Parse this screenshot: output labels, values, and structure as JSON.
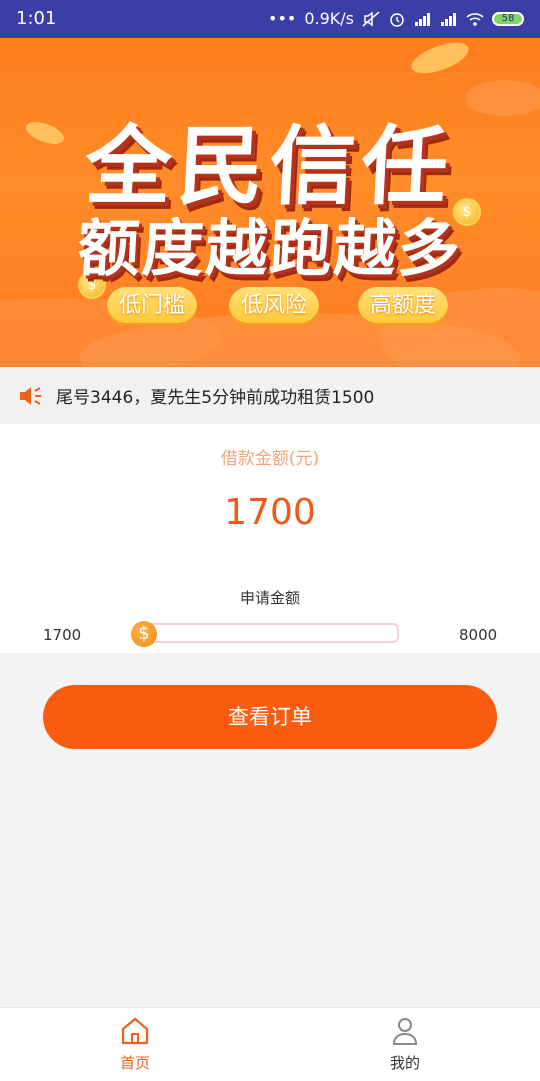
{
  "status_bar": {
    "time": "1:01",
    "network_speed": "0.9K/s",
    "battery": "58",
    "icons": [
      "more-dots-icon",
      "mute-icon",
      "alarm-icon",
      "signal-icon",
      "signal-icon",
      "wifi-icon",
      "battery-icon"
    ]
  },
  "banner": {
    "title_line1": "全民信任",
    "title_line2": "额度越跑越多",
    "tags": [
      "低门槛",
      "低风险",
      "高额度"
    ]
  },
  "notice": {
    "text": "尾号3446，夏先生5分钟前成功租赁1500"
  },
  "loan": {
    "amount_label": "借款金额(元)",
    "amount_value": "1700",
    "apply_label": "申请金额",
    "min": "1700",
    "max": "8000",
    "slider_fraction": 0,
    "thumb_symbol": "$"
  },
  "actions": {
    "view_order_label": "查看订单"
  },
  "bottom_nav": {
    "items": [
      {
        "label": "首页",
        "icon": "home-icon",
        "active": true
      },
      {
        "label": "我的",
        "icon": "user-icon",
        "active": false
      }
    ]
  },
  "colors": {
    "accent": "#fb5c12",
    "status_bar": "#3a3fa5",
    "banner": "#ff7d1b"
  }
}
